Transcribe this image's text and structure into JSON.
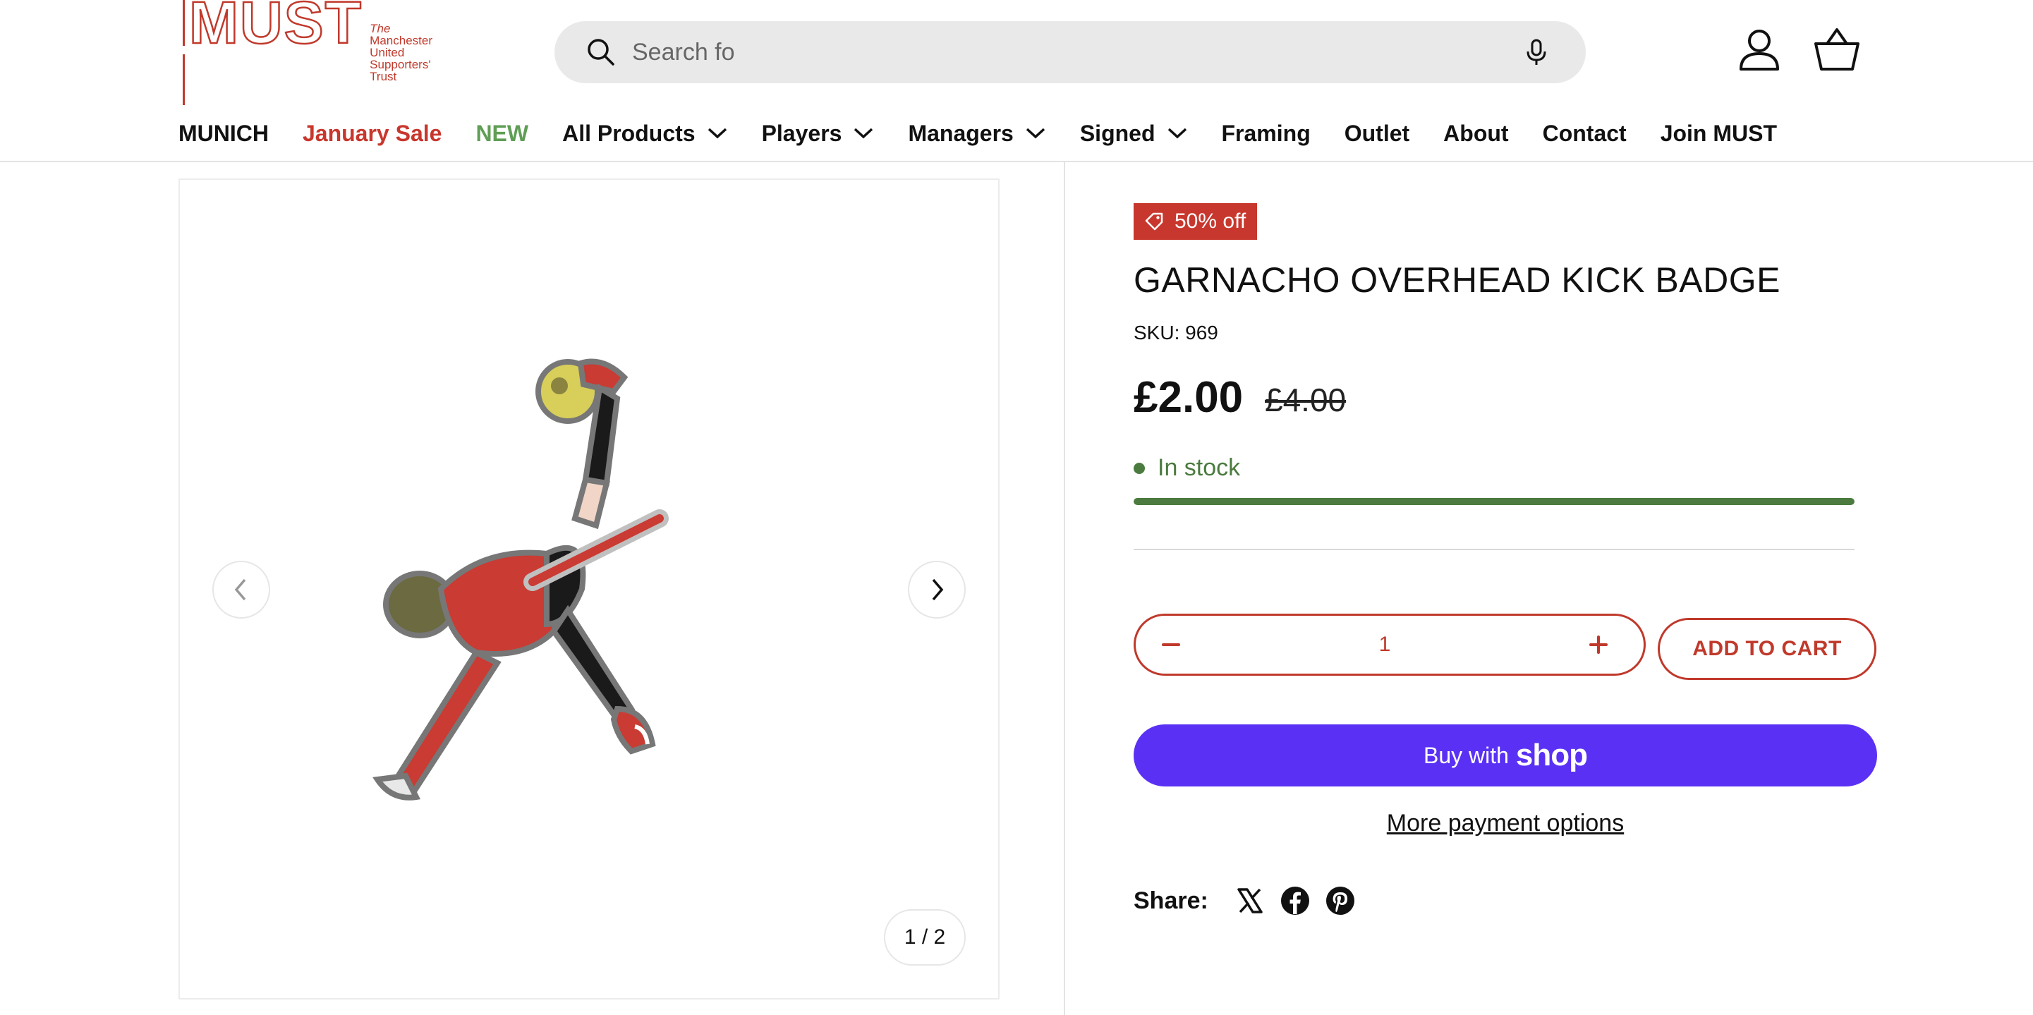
{
  "header": {
    "logo": {
      "mark": "MUST",
      "subtitle_lines": [
        "The",
        "Manchester",
        "United",
        "Supporters'",
        "Trust"
      ]
    },
    "search": {
      "placeholder": "Search fo"
    },
    "nav": [
      {
        "label": "MUNICH",
        "color": "#111111",
        "has_dropdown": false
      },
      {
        "label": "January Sale",
        "color": "#c8372d",
        "has_dropdown": false
      },
      {
        "label": "NEW",
        "color": "#5f9e55",
        "has_dropdown": false
      },
      {
        "label": "All Products",
        "color": "#111111",
        "has_dropdown": true
      },
      {
        "label": "Players",
        "color": "#111111",
        "has_dropdown": true
      },
      {
        "label": "Managers",
        "color": "#111111",
        "has_dropdown": true
      },
      {
        "label": "Signed",
        "color": "#111111",
        "has_dropdown": true
      },
      {
        "label": "Framing",
        "color": "#111111",
        "has_dropdown": false
      },
      {
        "label": "Outlet",
        "color": "#111111",
        "has_dropdown": false
      },
      {
        "label": "About",
        "color": "#111111",
        "has_dropdown": false
      },
      {
        "label": "Contact",
        "color": "#111111",
        "has_dropdown": false
      },
      {
        "label": "Join MUST",
        "color": "#111111",
        "has_dropdown": false
      }
    ]
  },
  "gallery": {
    "counter": "1 / 2",
    "icons": {
      "prev": "chevron-left-icon",
      "next": "chevron-right-icon"
    }
  },
  "product": {
    "sale_badge": "50% off",
    "title": "GARNACHO OVERHEAD KICK BADGE",
    "sku": "SKU: 969",
    "price": "£2.00",
    "compare_price": "£4.00",
    "stock_status": "In stock",
    "stock_level": 1.0,
    "quantity": "1",
    "add_to_cart": "ADD TO CART",
    "buy_with": "Buy with",
    "shop_word": "shop",
    "more_payment": "More payment options",
    "share_label": "Share:"
  },
  "colors": {
    "brand_red": "#c8372d",
    "stock_green": "#4b7b3f",
    "shop_purple": "#5a31f4",
    "nav_green": "#5f9e55"
  }
}
